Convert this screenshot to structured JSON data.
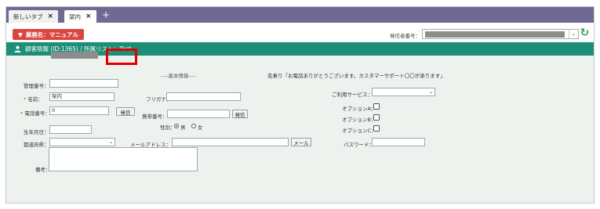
{
  "tabs": [
    {
      "label": "新しいタブ",
      "close": "×"
    },
    {
      "label": "架内",
      "close": "×"
    }
  ],
  "new_tab": "+",
  "header": {
    "business_label": "業務名：マニュアル",
    "business_arrow": "▼",
    "caller_label": "発信者番号：",
    "caller_dropdown": "⌄",
    "refresh_icon": "↻"
  },
  "section": {
    "title": "顧客情報 (ID:1365) / 所属リスト：Test"
  },
  "form": {
    "basic_info_heading": "----基本情報----",
    "greeting": "名乗り「お電話ありがとうございます。カスタマーサポート〇〇が承ります」",
    "management_no_label": "管理番号：",
    "name_label": "名前：",
    "name_value": "架内",
    "furigana_label": "フリガナ：",
    "phone_label": "電話番号：",
    "phone_prefix": "0",
    "call_button": "発信",
    "mobile_label": "携帯番号：",
    "mobile_call_button": "発信",
    "gender_label": "性別：",
    "gender_male": "男",
    "gender_female": "女",
    "birthday_label": "生年月日：",
    "prefecture_label": "都道府県：",
    "email_label": "メールアドレス：",
    "mail_button": "メール",
    "memo_label": "備考：",
    "service_label": "ご利用サービス：",
    "option_a_label": "オプションA：",
    "option_b_label": "オプションB：",
    "option_c_label": "オプションC：",
    "password_label": "パスワード："
  },
  "colors": {
    "tabbar": "#6e6a93",
    "business_badge": "#d9463f",
    "section_bar": "#1d8f78",
    "highlight": "#e00000"
  }
}
